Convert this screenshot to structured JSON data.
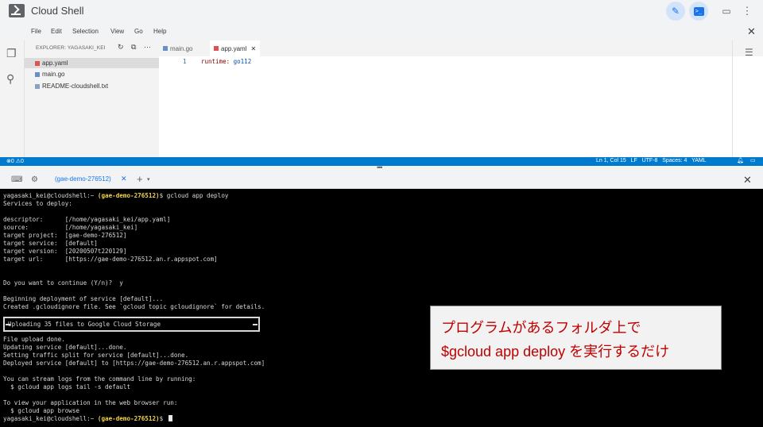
{
  "app": {
    "title": "Cloud Shell"
  },
  "menu": {
    "items": [
      "File",
      "Edit",
      "Selection",
      "View",
      "Go",
      "Help"
    ]
  },
  "explorer": {
    "title": "EXPLORER: YAGASAKI_KEI",
    "files": [
      {
        "name": "app.yaml",
        "type": "yaml",
        "active": true
      },
      {
        "name": "main.go",
        "type": "go",
        "active": false
      },
      {
        "name": "README-cloudshell.txt",
        "type": "txt",
        "active": false
      }
    ]
  },
  "editor": {
    "tabs": [
      {
        "label": "main.go",
        "active": false
      },
      {
        "label": "app.yaml",
        "active": true
      }
    ],
    "lines": [
      {
        "num": "1",
        "key": "runtime:",
        "value": "go112"
      }
    ]
  },
  "statusbar": {
    "problems": "⊗0 ⚠0",
    "right": "Ln 1, Col 15   LF   UTF-8   Spaces: 4   YAML"
  },
  "terminal": {
    "tab_label": "(gae-demo-276512)",
    "prompt_user": "yagasaki_kei@cloudshell:~",
    "prompt_project": "(gae-demo-276512)",
    "command": "$ gcloud app deploy",
    "lines": [
      "Services to deploy:",
      "",
      "descriptor:      [/home/yagasaki_kei/app.yaml]",
      "source:          [/home/yagasaki_kei]",
      "target project:  [gae-demo-276512]",
      "target service:  [default]",
      "target version:  [20200507t220129]",
      "target url:      [https://gae-demo-276512.an.r.appspot.com]",
      "",
      "",
      "Do you want to continue (Y/n)?  y",
      "",
      "Beginning deployment of service [default]...",
      "Created .gcloudignore file. See `gcloud topic gcloudignore` for details."
    ],
    "upload_text": "Uploading 35 files to Google Cloud Storage",
    "lines_after": [
      "File upload done.",
      "Updating service [default]...done.",
      "Setting traffic split for service [default]...done.",
      "Deployed service [default] to [https://gae-demo-276512.an.r.appspot.com]",
      "",
      "You can stream logs from the command line by running:",
      "  $ gcloud app logs tail -s default",
      "",
      "To view your application in the web browser run:",
      "  $ gcloud app browse"
    ],
    "final_prompt_suffix": "$"
  },
  "callout": {
    "line1": "プログラムがあるフォルダ上で",
    "line2": "$gcloud app deploy を実行するだけ"
  },
  "colors": {
    "accent": "#1a73e8",
    "statusbar": "#007acc",
    "callout_text": "#c00000",
    "project": "#f3d24b"
  }
}
